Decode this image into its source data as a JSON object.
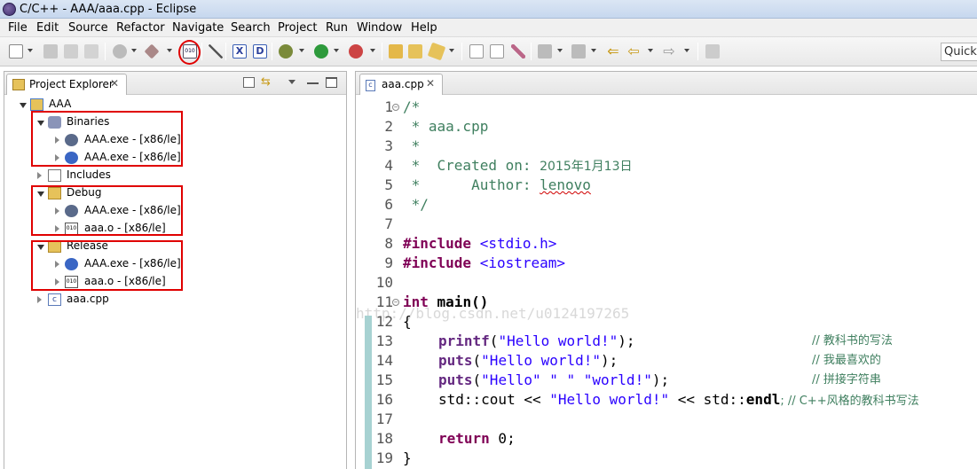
{
  "window": {
    "title": "C/C++ - AAA/aaa.cpp - Eclipse"
  },
  "menu": [
    "File",
    "Edit",
    "Source",
    "Refactor",
    "Navigate",
    "Search",
    "Project",
    "Run",
    "Window",
    "Help"
  ],
  "toolbar": {
    "quick_access": "Quick A"
  },
  "project_explorer": {
    "tab_label": "Project Explorer",
    "tree": [
      {
        "label": "AAA",
        "icon": "project-folder-icon"
      },
      {
        "label": "Binaries",
        "icon": "binaries-icon"
      },
      {
        "label": "AAA.exe - [x86/le]",
        "icon": "debug-bug-icon"
      },
      {
        "label": "AAA.exe - [x86/le]",
        "icon": "run-play-icon"
      },
      {
        "label": "Includes",
        "icon": "includes-icon"
      },
      {
        "label": "Debug",
        "icon": "folder-icon"
      },
      {
        "label": "AAA.exe - [x86/le]",
        "icon": "debug-bug-icon"
      },
      {
        "label": "aaa.o - [x86/le]",
        "icon": "object-file-icon"
      },
      {
        "label": "Release",
        "icon": "folder-icon"
      },
      {
        "label": "AAA.exe - [x86/le]",
        "icon": "run-play-icon"
      },
      {
        "label": "aaa.o - [x86/le]",
        "icon": "object-file-icon"
      },
      {
        "label": "aaa.cpp",
        "icon": "cpp-file-icon"
      }
    ]
  },
  "editor": {
    "tab_label": "aaa.cpp",
    "watermark": "http://blog.csdn.net/u0124197265",
    "line_numbers": [
      "1",
      "2",
      "3",
      "4",
      "5",
      "6",
      "7",
      "8",
      "9",
      "10",
      "11",
      "12",
      "13",
      "14",
      "15",
      "16",
      "17",
      "18",
      "19"
    ],
    "lines": {
      "l1": "/*",
      "l2": " * aaa.cpp",
      "l3": " *",
      "l4a": " *  Created on: ",
      "l4b": "2015年1月13日",
      "l5a": " *      Author: ",
      "l5b": "lenovo",
      "l7": " */",
      "l8kw": "#include",
      "l8inc": " <stdio.h>",
      "l9kw": "#include",
      "l9inc": " <iostream>",
      "l11kw": "int",
      "l11rest": " main()",
      "l12": "{",
      "l13fn": "printf",
      "l13a": "(",
      "l13str": "\"Hello world!\"",
      "l13b": ");",
      "l13c": "// 教科书的写法",
      "l14fn": "puts",
      "l14a": "(",
      "l14str": "\"Hello world!\"",
      "l14b": ");",
      "l14c": "// 我最喜欢的",
      "l15fn": "puts",
      "l15a": "(",
      "l15str": "\"Hello\" \" \" \"world!\"",
      "l15b": ");",
      "l15c": "// 拼接字符串",
      "l16a": "std::cout << ",
      "l16str": "\"Hello world!\"",
      "l16b": " << std::",
      "l16kw": "endl",
      "l16c": "; // C++风格的教科书写法",
      "l18kw": "return",
      "l18rest": " 0;",
      "l19": "}"
    }
  }
}
